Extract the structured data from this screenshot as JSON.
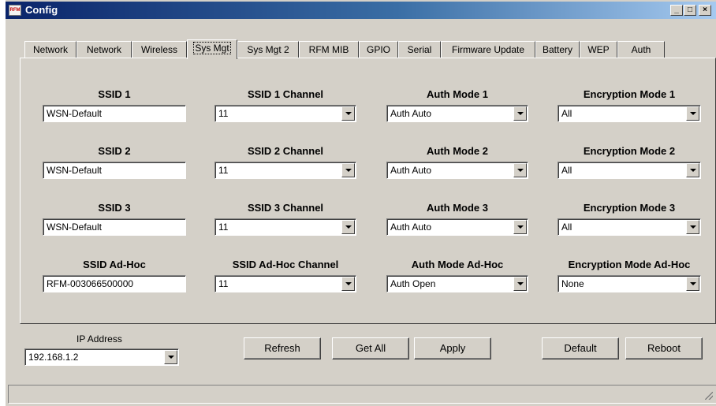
{
  "window": {
    "title": "Config",
    "icon_text": "RFM",
    "minimize_glyph": "_",
    "maximize_glyph": "□",
    "close_glyph": "×"
  },
  "tabs": [
    "Network",
    "Network",
    "Wireless",
    "Sys Mgt",
    "Sys Mgt 2",
    "RFM MIB",
    "GPIO",
    "Serial",
    "Firmware Update",
    "Battery",
    "WEP",
    "Auth"
  ],
  "active_tab": "Sys Mgt",
  "rows": [
    {
      "ssid_label": "SSID 1",
      "ssid_value": "WSN-Default",
      "channel_label": "SSID 1 Channel",
      "channel_value": "11",
      "auth_label": "Auth Mode 1",
      "auth_value": "Auth Auto",
      "enc_label": "Encryption Mode 1",
      "enc_value": "All"
    },
    {
      "ssid_label": "SSID 2",
      "ssid_value": "WSN-Default",
      "channel_label": "SSID 2 Channel",
      "channel_value": "11",
      "auth_label": "Auth Mode 2",
      "auth_value": "Auth Auto",
      "enc_label": "Encryption Mode 2",
      "enc_value": "All"
    },
    {
      "ssid_label": "SSID 3",
      "ssid_value": "WSN-Default",
      "channel_label": "SSID 3 Channel",
      "channel_value": "11",
      "auth_label": "Auth Mode 3",
      "auth_value": "Auth Auto",
      "enc_label": "Encryption Mode 3",
      "enc_value": "All"
    },
    {
      "ssid_label": "SSID Ad-Hoc",
      "ssid_value": "RFM-003066500000",
      "channel_label": "SSID Ad-Hoc Channel",
      "channel_value": "11",
      "auth_label": "Auth Mode Ad-Hoc",
      "auth_value": "Auth Open",
      "enc_label": "Encryption Mode Ad-Hoc",
      "enc_value": "None"
    }
  ],
  "footer": {
    "ip_label": "IP Address",
    "ip_value": "192.168.1.2",
    "refresh": "Refresh",
    "get_all": "Get All",
    "apply": "Apply",
    "default": "Default",
    "reboot": "Reboot"
  },
  "colors": {
    "face": "#d4d0c8",
    "title_start": "#0a246a",
    "title_end": "#a6caf0"
  }
}
